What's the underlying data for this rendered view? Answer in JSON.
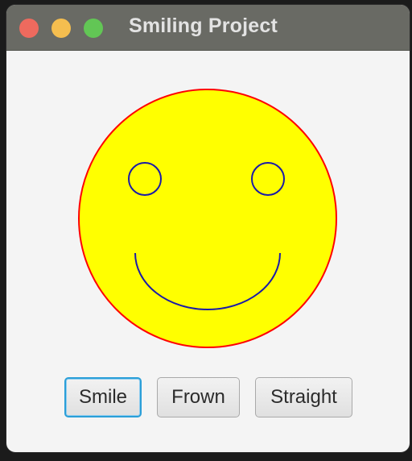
{
  "window": {
    "title": "Smiling Project"
  },
  "face": {
    "fill_color": "#ffff00",
    "outline_color": "#ff0000",
    "feature_color": "#1a1aa8",
    "expression": "smile"
  },
  "buttons": {
    "smile_label": "Smile",
    "frown_label": "Frown",
    "straight_label": "Straight",
    "focused": "smile"
  }
}
